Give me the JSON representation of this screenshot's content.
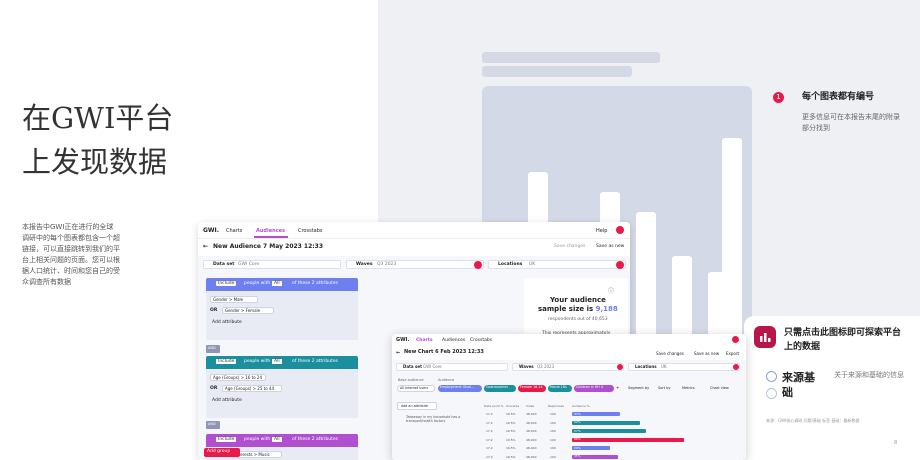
{
  "page": {
    "title_line1": "在GWI平台",
    "title_line2": "上发现数据",
    "intro": "本报告中GWI正在进行的全球调研中的每个图表都包含一个超链接，可以直接跳转到我们的平台上相关问题的页面。您可以根据人口统计、时间和您自己的受众调查所有数据",
    "note_badge": "1",
    "note_title": "每个图表都有编号",
    "note_desc": "更多信息可在本报告末尾的附录部分找到",
    "cta_text": "只需点击此图标即可探索平台上的数据",
    "source_title": "来源基础",
    "source_desc": "关于来源和基础的信息",
    "footnote": "来源：GWI核心调研 问题/基础 标签  基础：最新数据",
    "page_number": "8"
  },
  "app1": {
    "logo": "GWI.",
    "tabs": [
      "Charts",
      "Audiences",
      "Crosstabs"
    ],
    "help": "Help",
    "back_title": "New Audience 7 May 2023 12:33",
    "save_changes": "Save changes",
    "save_as_new": "Save as new",
    "dataset_label": "Data set",
    "dataset_value": "GWI Core",
    "waves_label": "Waves",
    "waves_value": "Q3 2023",
    "locations_label": "Locations",
    "locations_value": "UK",
    "include": "Include",
    "people_with": "people with",
    "all": "All",
    "of_these": "of these 2 attributes",
    "attr1": "Gender > Male",
    "or": "OR",
    "attr2": "Gender > Female",
    "attr3": "Age (Groups) > 16 to 24",
    "attr4": "Age (Groups) > 25 to 44",
    "add_attribute": "Add attribute",
    "and": "AND",
    "attr5": "Interests > Music",
    "add_group": "Add group",
    "sample_title_a": "Your audience",
    "sample_title_b": "sample size is ",
    "sample_value": "9,188",
    "sample_sub": "respondents out of 40,653",
    "sample_foot": "This represents approximately"
  },
  "app2": {
    "logo": "GWI.",
    "tabs": [
      "Charts",
      "Audiences",
      "Crosstabs"
    ],
    "back_title": "New Chart 6 Feb 2023 12:33",
    "save_changes": "Save changes",
    "save_as_new": "Save as new",
    "export": "Export",
    "dataset_label": "Data set",
    "dataset_value": "GWI Core",
    "waves_label": "Waves",
    "waves_value": "Q3 2023",
    "locations_label": "Locations",
    "locations_value": "UK",
    "base_audience_label": "Base audience",
    "audience_label": "Audience",
    "base_audience": "All Internet users",
    "audiences": [
      "Employment: Stud...",
      "Gastronomes",
      "Female 16-24",
      "Movie 18s",
      "Children in HH 4"
    ],
    "segment_by": "Segment by",
    "sort_by": "Sort by",
    "metrics": "Metrics",
    "chart_view": "Chart view",
    "add_attrs": "Add an attribute",
    "row_label": "Takeaway in my household has a transport/health factors",
    "col_headers": [
      "Data point %",
      "Universe",
      "Index",
      "Responses",
      "Audience %"
    ],
    "rows": [
      {
        "dp": "17.2",
        "uni": "16.5%",
        "idx": "48,000",
        "resp": "100",
        "pct": "37%",
        "val": 0.37
      },
      {
        "dp": "17.2",
        "uni": "16.5%",
        "idx": "48,000",
        "resp": "100",
        "pct": "52%",
        "val": 0.52
      },
      {
        "dp": "17.2",
        "uni": "16.5%",
        "idx": "48,000",
        "resp": "100",
        "pct": "57%",
        "val": 0.57
      },
      {
        "dp": "17.2",
        "uni": "16.5%",
        "idx": "48,000",
        "resp": "100",
        "pct": "86%",
        "val": 0.86
      },
      {
        "dp": "17.2",
        "uni": "16.5%",
        "idx": "48,000",
        "resp": "100",
        "pct": "29%",
        "val": 0.29
      },
      {
        "dp": "17.2",
        "uni": "16.5%",
        "idx": "48,000",
        "resp": "100",
        "pct": "35%",
        "val": 0.35
      }
    ]
  },
  "colors": {
    "accent": "#e8194b",
    "brand_dark": "#b81648",
    "blue_group": "#6e7ff0",
    "teal_group": "#1b8f9e",
    "purple_group": "#b04fd0"
  }
}
